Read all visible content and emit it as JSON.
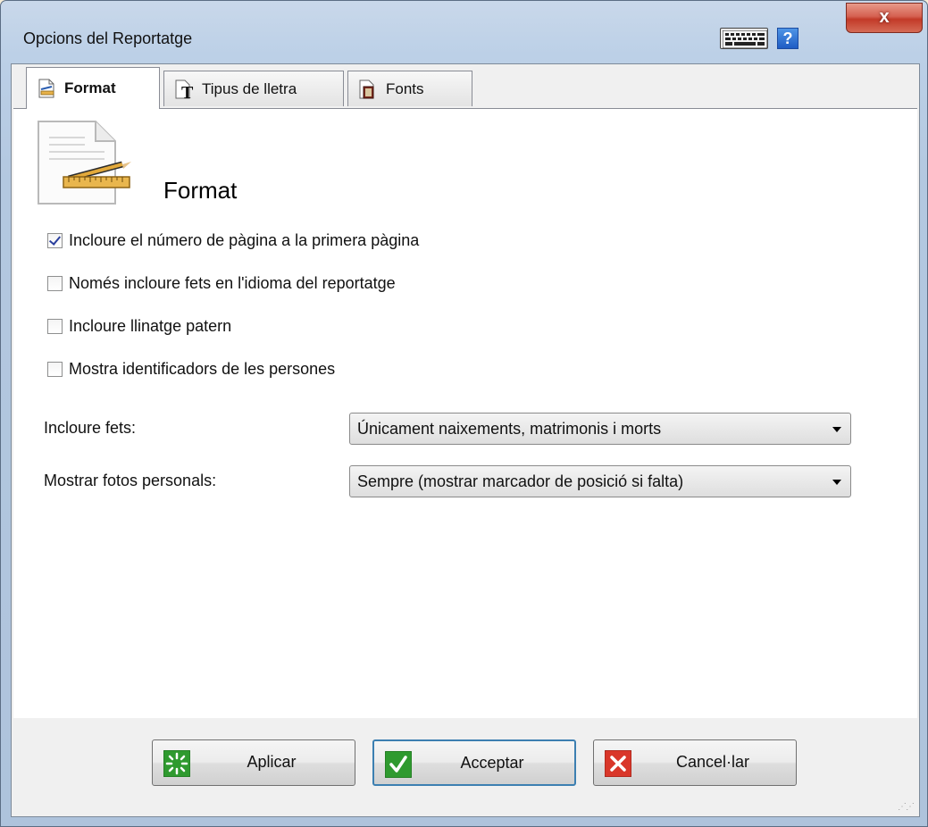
{
  "window": {
    "title": "Opcions del Reportatge",
    "close_label": "x",
    "help_label": "?"
  },
  "tabs": [
    {
      "label": "Format",
      "icon": "page-setup-icon",
      "active": true
    },
    {
      "label": "Tipus de lletra",
      "icon": "font-icon",
      "active": false
    },
    {
      "label": "Fonts",
      "icon": "sources-book-icon",
      "active": false
    }
  ],
  "panel": {
    "title": "Format",
    "checkboxes": [
      {
        "label": "Incloure el número de pàgina a la primera pàgina",
        "checked": true
      },
      {
        "label": "Només incloure fets en l'idioma del reportatge",
        "checked": false
      },
      {
        "label": "Incloure llinatge patern",
        "checked": false
      },
      {
        "label": "Mostra identificadors de les persones",
        "checked": false
      }
    ],
    "include_events": {
      "label": "Incloure fets:",
      "value": "Únicament naixements, matrimonis i morts"
    },
    "show_photos": {
      "label": "Mostrar fotos personals:",
      "value": "Sempre (mostrar marcador de posició si falta)"
    }
  },
  "buttons": {
    "apply": "Aplicar",
    "accept": "Acceptar",
    "cancel": "Cancel·lar"
  },
  "colors": {
    "accent_default_button": "#3c7fb1",
    "apply_icon": "#2f9a2f",
    "accept_icon": "#2f9a2f",
    "cancel_icon": "#d9372a"
  }
}
